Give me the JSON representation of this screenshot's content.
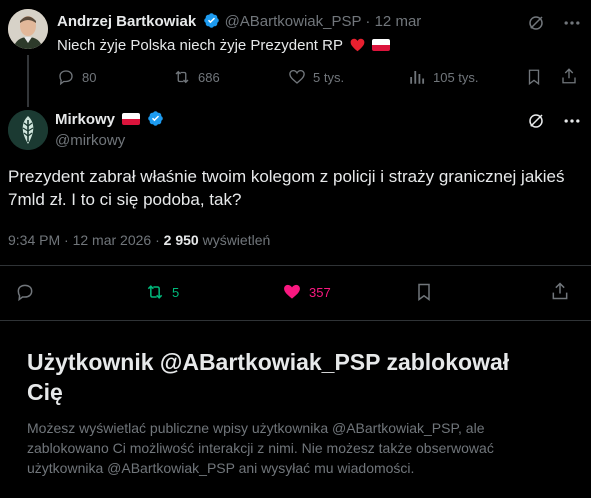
{
  "reply_to_tweet": {
    "author_name": "Andrzej Bartkowiak",
    "handle": "@ABartkowiak_PSP",
    "separator": "·",
    "date": "12 mar",
    "text": "Niech żyje Polska niech żyje Prezydent RP",
    "stats": {
      "replies": "80",
      "retweets": "686",
      "likes": "5 tys.",
      "views": "105 tys."
    }
  },
  "main_tweet": {
    "author_name": "Mirkowy",
    "handle": "@mirkowy",
    "text": "Prezydent zabrał właśnie twoim kolegom z policji i straży granicznej jakieś 7mld zł. I to ci się podoba, tak?",
    "timestamp": "9:34 PM · 12 mar 2026 ·",
    "views_count": "2 950",
    "views_label": "wyświetleń",
    "stats": {
      "retweets": "5",
      "likes": "357"
    }
  },
  "blocked_notice": {
    "title": "Użytkownik @ABartkowiak_PSP zablokował Cię",
    "description": "Możesz wyświetlać publiczne wpisy użytkownika @ABartkowiak_PSP, ale zablokowano Ci możliwość interakcji z nimi. Nie możesz także obserwować użytkownika @ABartkowiak_PSP ani wysyłać mu wiadomości."
  },
  "colors": {
    "background": "#000000",
    "text": "#e7e9ea",
    "muted": "#71767b",
    "verified": "#1d9bf0",
    "retweet_active": "#00ba7c",
    "like_active": "#f91880"
  }
}
